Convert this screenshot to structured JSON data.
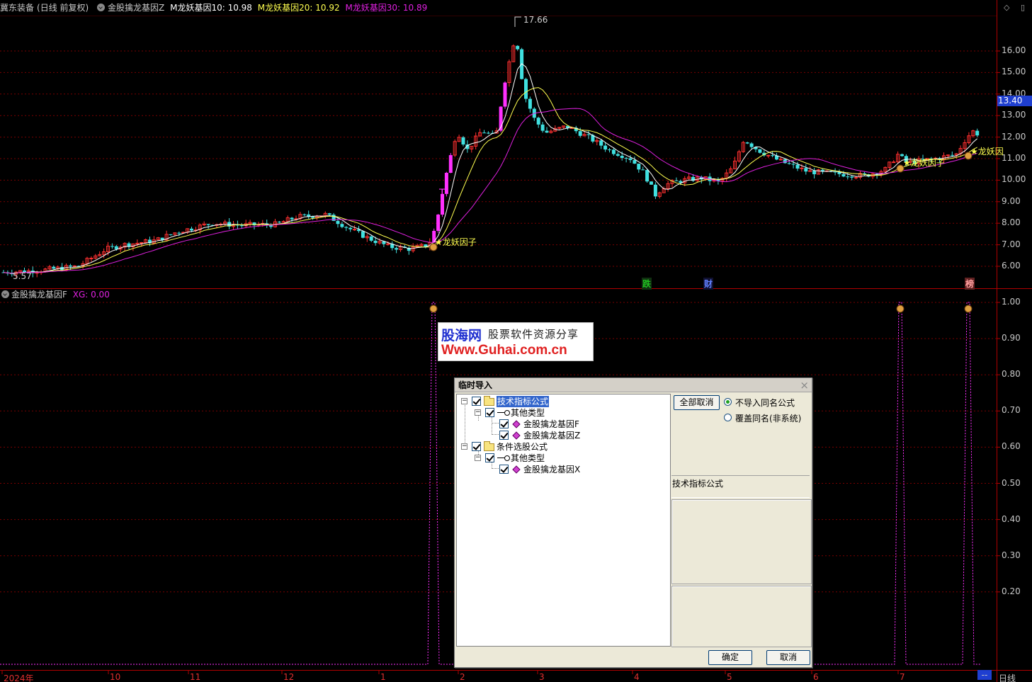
{
  "header": {
    "stock": "冀东装备",
    "period_note": "(日线 前复权)",
    "indicator_name": "金股擒龙基因Z",
    "ma10_label": "M龙妖基因10: 10.98",
    "ma20_label": "M龙妖基因20: 10.92",
    "ma30_label": "M龙妖基因30: 10.89",
    "window_controls": "◇ ▯"
  },
  "upper_chart": {
    "high_label": "17.66",
    "low_label": "5.57",
    "current_price": "13.40",
    "y_ticks": [
      "16.00",
      "15.00",
      "14.00",
      "13.00",
      "12.00",
      "11.00",
      "10.00",
      "9.00",
      "8.00",
      "7.00",
      "6.00"
    ],
    "signal_text": "★龙妖因子",
    "signal_text_2": "★龙妖因子",
    "signal_text_3": "★龙妖因",
    "t_marker": "T",
    "markers": {
      "die": "跌",
      "cai": "财",
      "bang": "榜"
    }
  },
  "lower_chart": {
    "title": "金股擒龙基因F",
    "xg_label": "XG: 0.00",
    "y_ticks": [
      "1.00",
      "0.90",
      "0.80",
      "0.70",
      "0.60",
      "0.50",
      "0.40",
      "0.30",
      "0.20"
    ]
  },
  "date_axis": {
    "labels": [
      "2024年",
      "10",
      "11",
      "12",
      "1",
      "2",
      "3",
      "4",
      "5",
      "6",
      "7"
    ],
    "period": "日线",
    "more": "--"
  },
  "watermark": {
    "logo": "股海网",
    "tagline": "股票软件资源分享",
    "url": "Www.Guhai.com.cn"
  },
  "dialog": {
    "title": "临时导入",
    "close": "×",
    "tree": {
      "group1": "技术指标公式",
      "group1_sub": "其他类型",
      "item_f": "金股擒龙基因F",
      "item_z": "金股擒龙基因Z",
      "group2": "条件选股公式",
      "group2_sub": "其他类型",
      "item_x": "金股擒龙基因X"
    },
    "deselect_all": "全部取消",
    "radio_no_import": "不导入同名公式",
    "radio_overwrite": "覆盖同名(非系统)",
    "desc_header": "技术指标公式",
    "ok": "确定",
    "cancel": "取消"
  },
  "colors": {
    "up_candle": "#ff3030",
    "down_candle": "#40e0e0",
    "limit_up": "#ff30ff",
    "ma_white": "#ffffff",
    "ma_yellow": "#ffff50",
    "ma_magenta": "#e020e0",
    "grid": "#7a0000",
    "frame": "#b00000"
  }
}
